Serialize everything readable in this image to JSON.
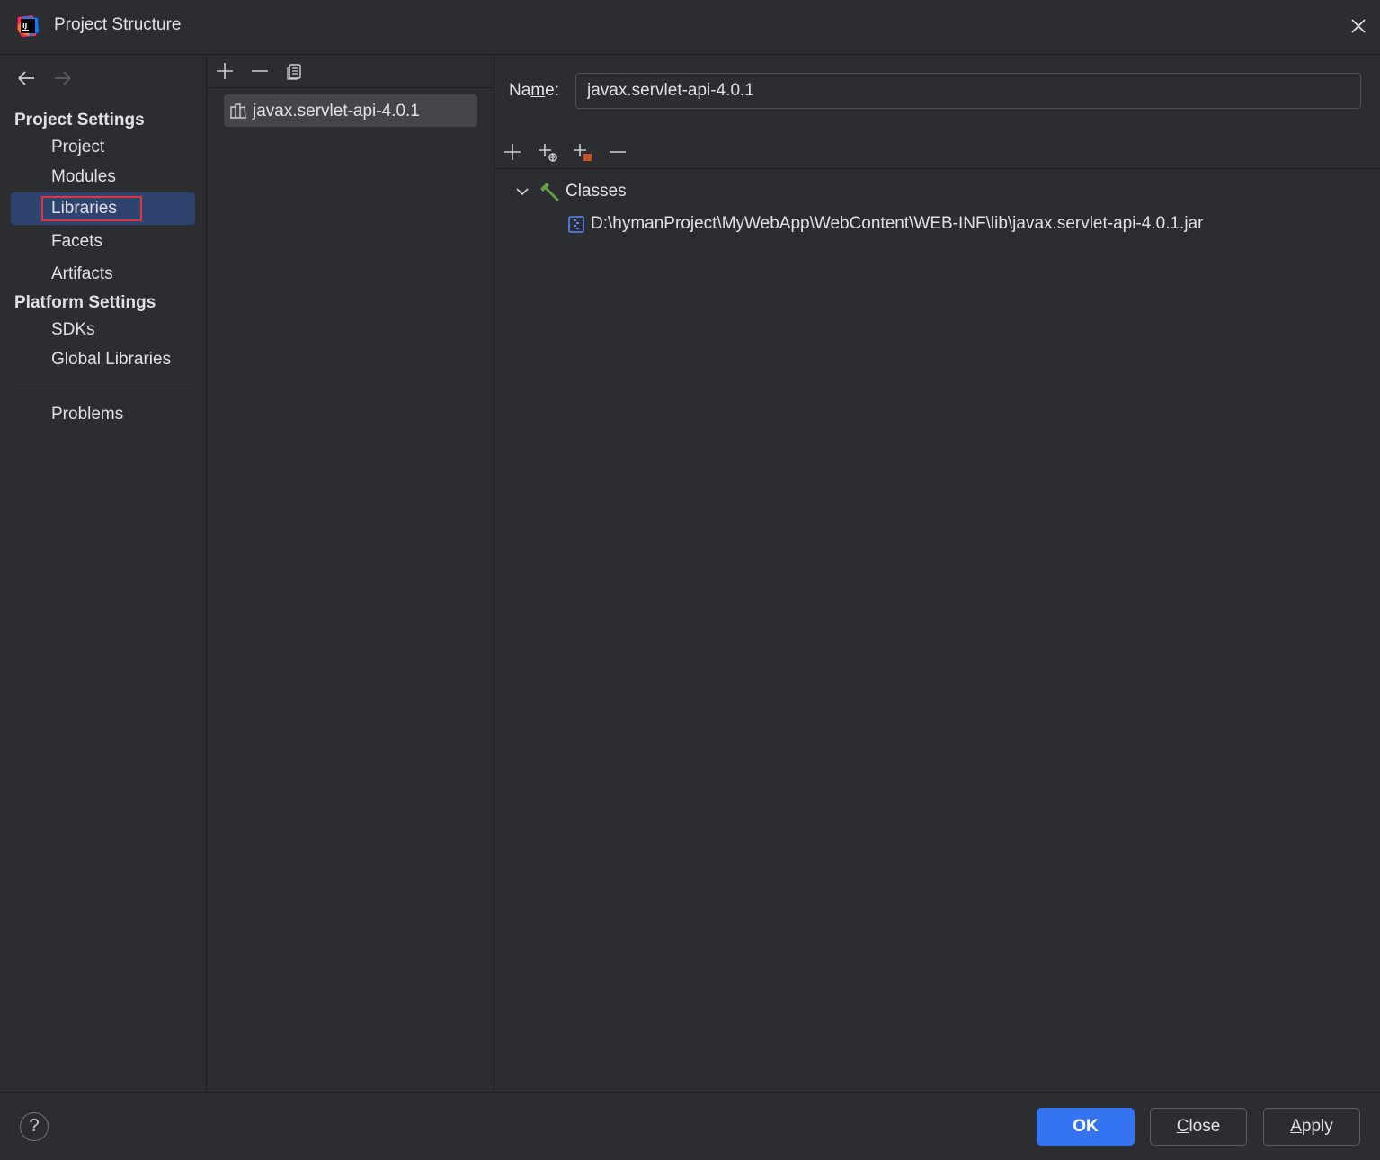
{
  "window": {
    "title": "Project Structure"
  },
  "nav": {
    "project_settings_header": "Project Settings",
    "project_settings_items": [
      {
        "label": "Project"
      },
      {
        "label": "Modules"
      },
      {
        "label": "Libraries",
        "selected": true
      },
      {
        "label": "Facets"
      },
      {
        "label": "Artifacts"
      }
    ],
    "platform_settings_header": "Platform Settings",
    "platform_settings_items": [
      {
        "label": "SDKs"
      },
      {
        "label": "Global Libraries"
      }
    ],
    "problems_label": "Problems"
  },
  "libraries": {
    "items": [
      {
        "label": "javax.servlet-api-4.0.1",
        "selected": true
      }
    ]
  },
  "detail": {
    "name_label_pre": "Na",
    "name_label_mnemonic": "m",
    "name_label_post": "e:",
    "name_value": "javax.servlet-api-4.0.1",
    "tree": {
      "root_label": "Classes",
      "root_expanded": true,
      "children": [
        {
          "label": "D:\\hymanProject\\MyWebApp\\WebContent\\WEB-INF\\lib\\javax.servlet-api-4.0.1.jar"
        }
      ]
    }
  },
  "buttons": {
    "ok": "OK",
    "close_mnemonic": "C",
    "close_rest": "lose",
    "apply_mnemonic": "A",
    "apply_rest": "pply",
    "help": "?"
  },
  "colors": {
    "background": "#2b2d30",
    "selection": "#2e436e",
    "primary_button": "#3574f0",
    "highlight_box": "#e0353e",
    "classes_icon": "#5fa346"
  },
  "icons": {
    "app": "intellij-logo-icon",
    "close": "close-icon",
    "back": "arrow-left-icon",
    "forward": "arrow-right-icon",
    "add": "plus-icon",
    "remove": "minus-icon",
    "copy": "copy-icon",
    "library": "library-icon",
    "chevron": "chevron-down-icon",
    "classes": "hammer-icon",
    "jar": "jar-file-icon"
  }
}
